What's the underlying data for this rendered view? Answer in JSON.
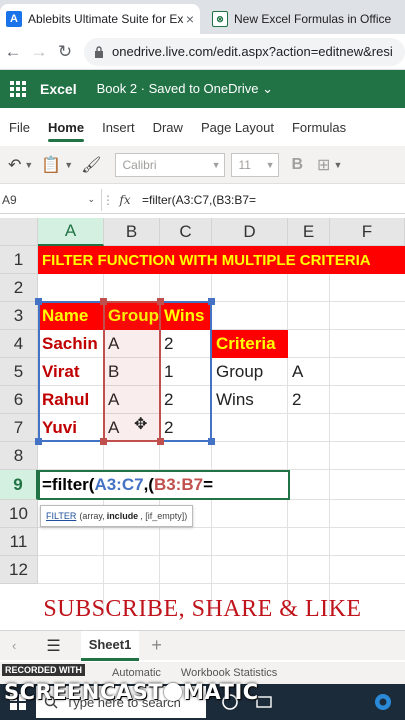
{
  "browser": {
    "tabs": [
      {
        "label": "Ablebits Ultimate Suite for Ex",
        "icon": "ablebits-icon"
      },
      {
        "label": "New Excel Formulas in Office",
        "icon": "excel-favicon"
      }
    ],
    "url": "onedrive.live.com/edit.aspx?action=editnew&resi"
  },
  "excel": {
    "app_name": "Excel",
    "doc_title": "Book 2  ·  Saved to OneDrive ⌄",
    "doc_title_plain": "Book 2 - Saved to OneDrive",
    "ribbon_tabs": [
      "File",
      "Home",
      "Insert",
      "Draw",
      "Page Layout",
      "Formulas"
    ],
    "active_tab": "Home",
    "font_name": "Calibri",
    "font_size": "11",
    "bold_label": "B",
    "name_box": "A9",
    "fx_label": "fx",
    "formula": "=filter(A3:C7,(B3:B7="
  },
  "columns": [
    "A",
    "B",
    "C",
    "D",
    "E",
    "F"
  ],
  "rows": [
    "1",
    "2",
    "3",
    "4",
    "5",
    "6",
    "7",
    "8",
    "9",
    "10",
    "11",
    "12"
  ],
  "cells": {
    "title": "FILTER FUNCTION WITH MULTIPLE CRITERIA",
    "headers": [
      "Name",
      "Group",
      "Wins"
    ],
    "data": [
      [
        "Sachin",
        "A",
        "2"
      ],
      [
        "Virat",
        "B",
        "1"
      ],
      [
        "Rahul",
        "A",
        "2"
      ],
      [
        "Yuvi",
        "A",
        "2"
      ]
    ],
    "criteria_header": "Criteria",
    "criteria": [
      [
        "Group",
        "A"
      ],
      [
        "Wins",
        "2"
      ]
    ]
  },
  "editing": {
    "prefix": "=filter(",
    "ref1": "A3:C7",
    "sep": ",(",
    "ref2": "B3:B7",
    "suffix": "=",
    "tooltip_fn": "FILTER",
    "tooltip_pre": "(array,",
    "tooltip_cur": "include",
    "tooltip_post": ", [if_empty])"
  },
  "overlay_text": "SUBSCRIBE, SHARE & LIKE",
  "sheet_tabs": [
    "Sheet1"
  ],
  "status": {
    "calc": "Automatic",
    "stats": "Workbook Statistics"
  },
  "recorded_label": "RECORDED WITH",
  "watermark": {
    "left": "SCREENCAST",
    "right": "MATIC"
  },
  "taskbar": {
    "search_placeholder": "Type here to search"
  },
  "colors": {
    "excel_green": "#217346",
    "header_red": "#ff0000",
    "header_yellow": "#ffff00",
    "name_red": "#c00000",
    "ref_blue": "#4472c4",
    "ref_red": "#c0504d"
  }
}
